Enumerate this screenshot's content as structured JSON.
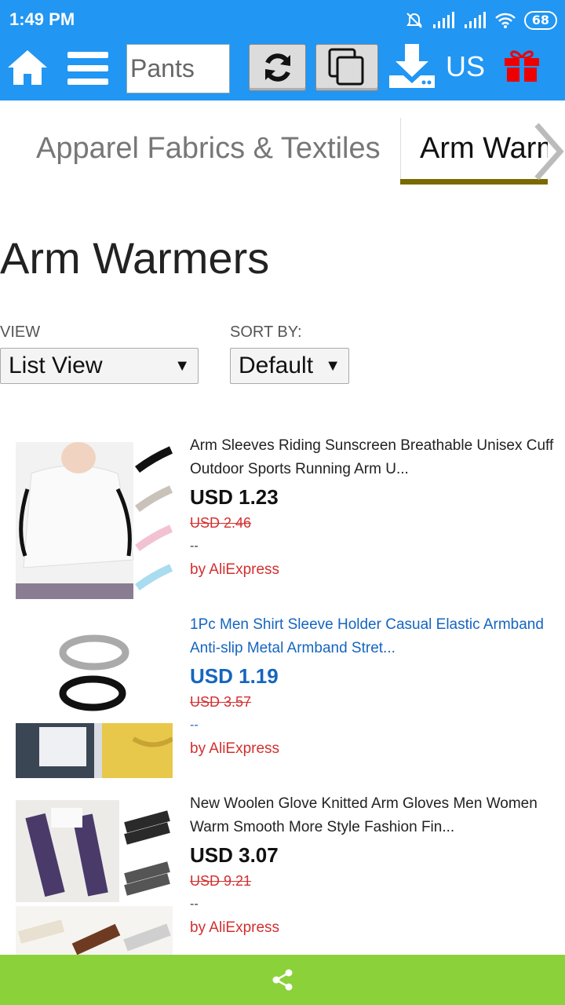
{
  "status_bar": {
    "time": "1:49 PM",
    "battery": "68"
  },
  "toolbar": {
    "search_value": "Pants",
    "region": "US",
    "icons": [
      "home-icon",
      "menu-icon",
      "refresh-icon",
      "copy-icon",
      "download-icon",
      "gift-icon"
    ]
  },
  "category_tabs": [
    {
      "label": "Apparel Fabrics & Textiles",
      "active": false
    },
    {
      "label": "Arm Warmers",
      "active": true
    }
  ],
  "page_title": "Arm Warmers",
  "view": {
    "label": "VIEW",
    "selected": "List View"
  },
  "sort": {
    "label": "SORT BY:",
    "selected": "Default"
  },
  "products": [
    {
      "title": "Arm Sleeves Riding Sunscreen Breathable Unisex Cuff Outdoor Sports Running Arm U...",
      "price": "USD 1.23",
      "old_price": "USD 2.46",
      "dash": "--",
      "seller": "by AliExpress"
    },
    {
      "title": "1Pc Men Shirt Sleeve Holder Casual Elastic Armband Anti-slip Metal Armband Stret...",
      "price": "USD 1.19",
      "old_price": "USD 3.57",
      "dash": "--",
      "seller": "by AliExpress"
    },
    {
      "title": "New Woolen Glove Knitted Arm Gloves Men Women Warm Smooth More Style Fashion Fin...",
      "price": "USD 3.07",
      "old_price": "USD 9.21",
      "dash": "--",
      "seller": "by AliExpress"
    }
  ],
  "colors": {
    "header_blue": "#2196f3",
    "bottom_green": "#8bd13a",
    "sale_red": "#d32f2f",
    "link_blue": "#1565c0",
    "tab_underline": "#7a6a00"
  }
}
